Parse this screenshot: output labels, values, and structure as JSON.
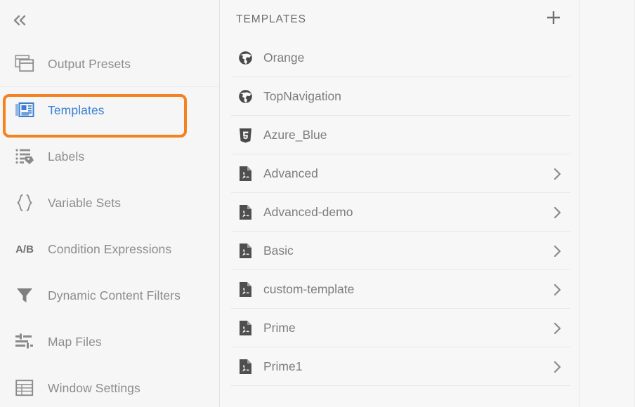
{
  "sidebar": {
    "collapse_icon": "chevrons-left-icon",
    "items": [
      {
        "label": "Output Presets",
        "icon": "windows-stack-icon",
        "active": false
      },
      {
        "label": "Templates",
        "icon": "template-page-icon",
        "active": true
      },
      {
        "label": "Labels",
        "icon": "list-tag-icon",
        "active": false
      },
      {
        "label": "Variable Sets",
        "icon": "curly-braces-icon",
        "active": false
      },
      {
        "label": "Condition Expressions",
        "icon": "ab-text-icon",
        "active": false
      },
      {
        "label": "Dynamic Content Filters",
        "icon": "funnel-icon",
        "active": false
      },
      {
        "label": "Map Files",
        "icon": "sliders-icon",
        "active": false
      },
      {
        "label": "Window Settings",
        "icon": "table-grid-icon",
        "active": false
      }
    ],
    "selection_highlight_color": "#f58220",
    "active_label_color": "#3b7fd4",
    "label_color": "#8c8c8c"
  },
  "panel": {
    "title": "TEMPLATES",
    "add_icon": "plus-icon",
    "chevron_icon": "chevron-right-icon",
    "templates": [
      {
        "name": "Orange",
        "icon": "globe-icon",
        "has_chevron": false
      },
      {
        "name": "TopNavigation",
        "icon": "globe-icon",
        "has_chevron": false
      },
      {
        "name": "Azure_Blue",
        "icon": "html5-icon",
        "has_chevron": false
      },
      {
        "name": "Advanced",
        "icon": "pdf-file-icon",
        "has_chevron": true
      },
      {
        "name": "Advanced-demo",
        "icon": "pdf-file-icon",
        "has_chevron": true
      },
      {
        "name": "Basic",
        "icon": "pdf-file-icon",
        "has_chevron": true
      },
      {
        "name": "custom-template",
        "icon": "pdf-file-icon",
        "has_chevron": true
      },
      {
        "name": "Prime",
        "icon": "pdf-file-icon",
        "has_chevron": true
      },
      {
        "name": "Prime1",
        "icon": "pdf-file-icon",
        "has_chevron": true
      }
    ]
  }
}
